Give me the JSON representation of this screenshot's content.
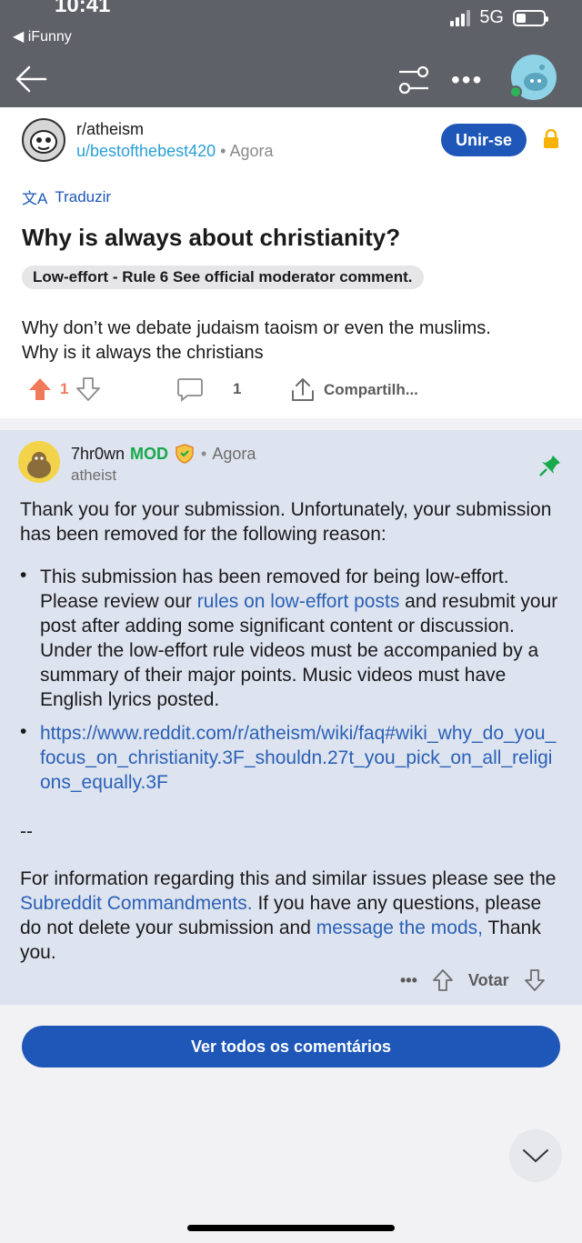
{
  "status": {
    "time": "10:41",
    "back_app": "◀ iFunny",
    "network": "5G"
  },
  "post": {
    "subreddit": "r/atheism",
    "author": "u/bestofthebest420",
    "separator": "•",
    "time": "Agora",
    "join_label": "Unir-se",
    "translate_label": "Traduzir",
    "translate_glyph": "文A",
    "title": "Why is always about christianity?",
    "flair": "Low-effort - Rule 6 See official moderator comment.",
    "body": "Why don’t we debate judaism taoism or even the muslims. Why is it always the christians",
    "upvotes": "1",
    "comments": "1",
    "share_label": "Compartilh..."
  },
  "comment": {
    "author": "7hr0wn",
    "mod_label": "MOD",
    "separator": "•",
    "time": "Agora",
    "flair": "atheist",
    "intro": "Thank you for your submission. Unfortunately, your submission has been removed for the following reason:",
    "bullet1_a": "This submission has been removed for being low-effort. Please review our",
    "bullet1_link": "rules on low-effort posts",
    "bullet1_b": "and resubmit your post after adding some significant content or discussion.  Under the low-effort rule videos must be accompanied by a summary of their major points.  Music videos must have English lyrics posted.",
    "bullet2_link": "https://www.reddit.com/r/atheism/wiki/faq#wiki_why_do_you_focus_on_christianity.3F_shouldn.27t_you_pick_on_all_religions_equally.3F",
    "separator_line": "--",
    "outro_a": "For information regarding this and similar issues please see the",
    "outro_link1": "Subreddit Commandments.",
    "outro_b": "If you have any questions, please do not delete your submission and",
    "outro_link2": "message the mods,",
    "outro_c": "Thank you.",
    "more": "•••",
    "vote_label": "Votar"
  },
  "view_all_label": "Ver todos os comentários",
  "colors": {
    "accent": "#1e57b8",
    "mod": "#17a94b",
    "upvote": "#f07a5a",
    "header": "#5e6168",
    "comment_bg": "#dde3ef"
  }
}
